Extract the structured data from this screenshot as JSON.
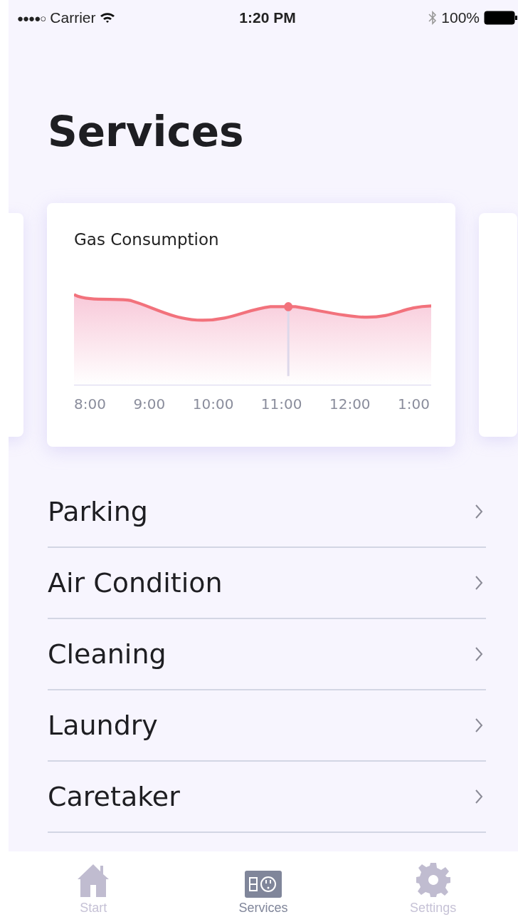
{
  "status_bar": {
    "signal": "●●●●○",
    "carrier": "Carrier",
    "time": "1:20 PM",
    "battery": "100%"
  },
  "title": "Services",
  "card": {
    "title": "Gas Consumption",
    "x_labels": [
      "8:00",
      "9:00",
      "10:00",
      "11:00",
      "12:00",
      "1:00"
    ]
  },
  "services": [
    {
      "label": "Parking"
    },
    {
      "label": "Air Condition"
    },
    {
      "label": "Cleaning"
    },
    {
      "label": "Laundry"
    },
    {
      "label": "Caretaker"
    }
  ],
  "tabs": [
    {
      "label": "Start",
      "kind": "home",
      "selected": false
    },
    {
      "label": "Services",
      "kind": "outlet",
      "selected": true
    },
    {
      "label": "Settings",
      "kind": "gear",
      "selected": false
    }
  ]
}
